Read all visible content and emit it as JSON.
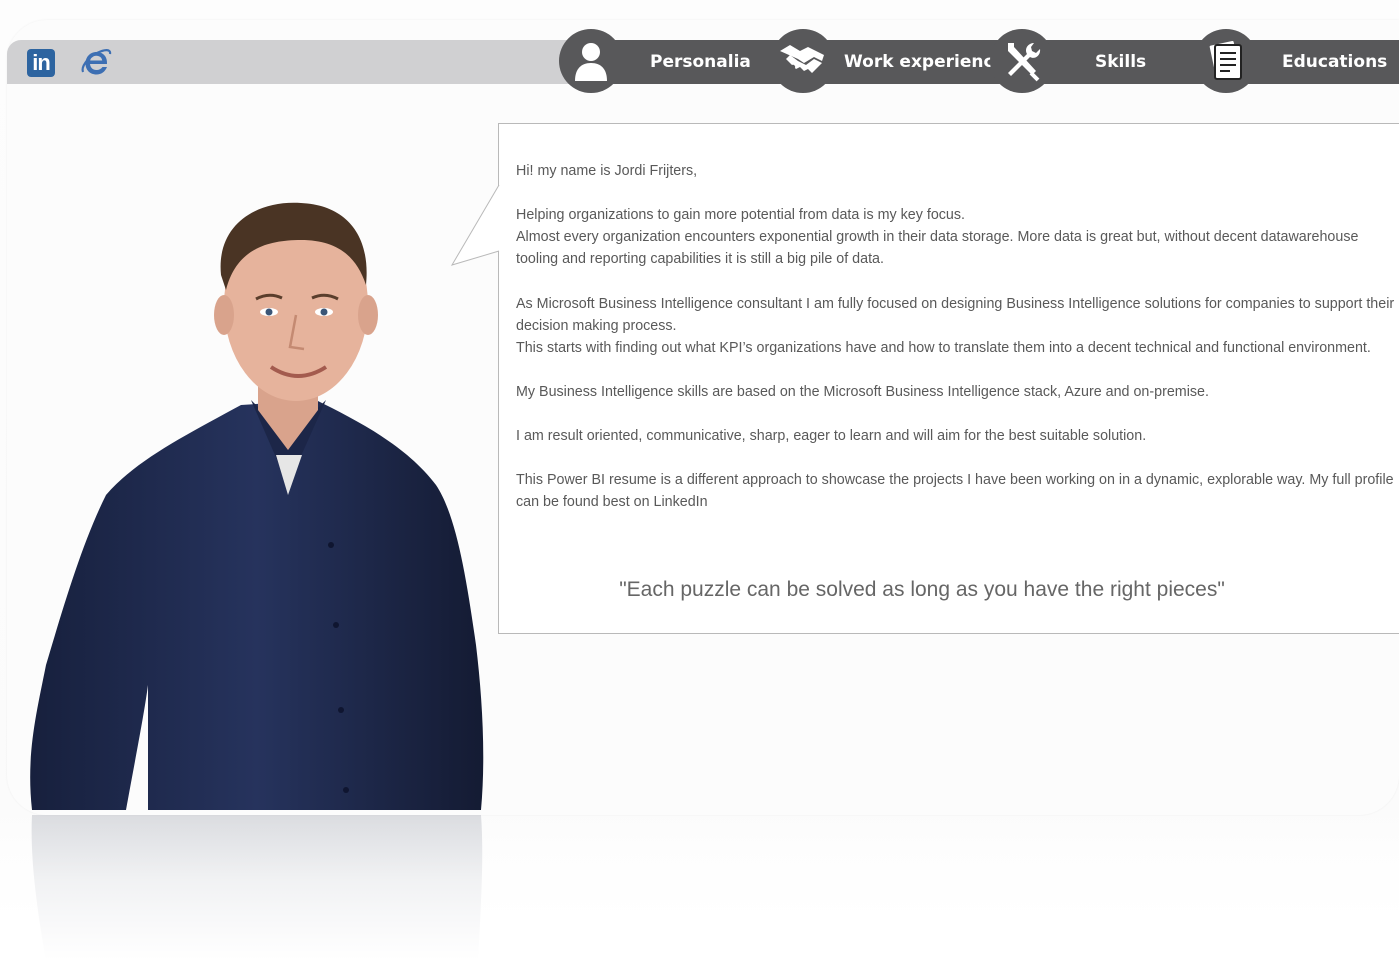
{
  "social": {
    "linkedin_label": "in",
    "linkedin_icon": "linkedin-icon",
    "web_icon": "internet-explorer-icon"
  },
  "nav": {
    "items": [
      {
        "label": "Personalia",
        "icon": "person-icon"
      },
      {
        "label": "Work experience",
        "icon": "handshake-icon"
      },
      {
        "label": "Skills",
        "icon": "tools-icon"
      },
      {
        "label": "Educations",
        "icon": "document-icon"
      }
    ]
  },
  "bio": {
    "paragraphs": [
      "Hi! my name is Jordi Frijters,",
      "Helping organizations to gain more potential from data is my key focus. Almost every organization encounters exponential growth in their data storage. More data is great but, without decent datawarehouse tooling and reporting capabilities it is still a big pile of data.",
      "As Microsoft Business Intelligence consultant I am fully focused on designing Business Intelligence solutions for companies to support their decision making process. This starts with finding out what KPI’s organizations have and how to translate them into a decent technical and functional environment.",
      "My Business Intelligence skills are based on the Microsoft Business Intelligence stack, Azure and on-premise.",
      "I am result oriented, communicative, sharp, eager to learn and will aim for the best suitable solution.",
      "This Power BI resume is a different approach to showcase the projects I have been working on in a dynamic, explorable way. My full profile can be found best on LinkedIn"
    ],
    "lines": {
      "p2a": "Helping organizations to gain more potential from data is my key focus.",
      "p2b": "Almost every organization encounters exponential growth in their data storage. More data is great but, without decent datawarehouse tooling and reporting capabilities it is still a big pile of data.",
      "p3a": "As Microsoft Business Intelligence consultant I am fully focused on designing Business Intelligence solutions for companies to support their decision making process.",
      "p3b": "This starts with finding out what KPI’s organizations have and how to translate them into a decent technical and functional environment."
    },
    "quote": "\"Each puzzle can be solved as long as you have the right pieces\""
  },
  "colors": {
    "topbar": "#d0d0d2",
    "nav": "#58585a",
    "linkedin": "#2d64a0",
    "text": "#595959",
    "shirt": "#1f2a4d"
  }
}
